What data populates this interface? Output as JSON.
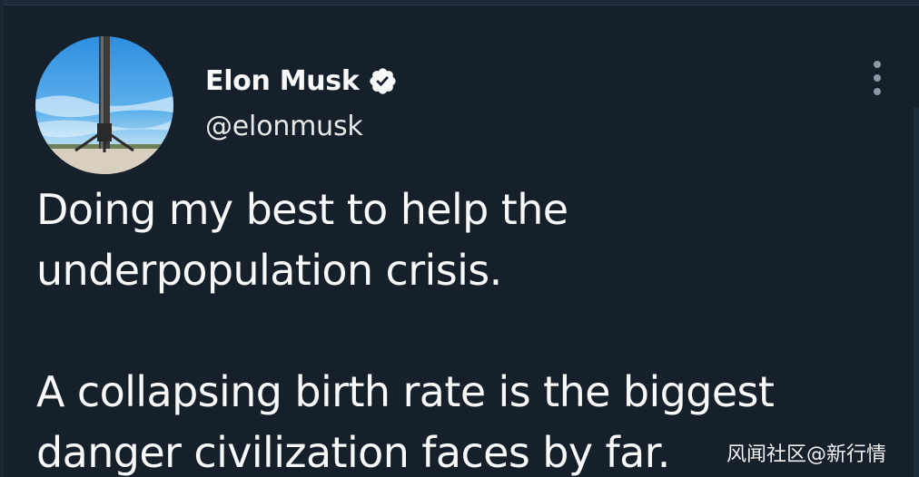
{
  "tweet": {
    "display_name": "Elon Musk",
    "handle": "@elonmusk",
    "verified": true,
    "text_lines": [
      "Doing my best to help the",
      "underpopulation crisis.",
      "A collapsing birth rate is the biggest",
      "danger civilization faces by far."
    ]
  },
  "icons": {
    "verified": "verified-badge-icon",
    "more": "more-vertical-icon",
    "avatar": "rocket-booster-avatar"
  },
  "colors": {
    "background": "#15202b",
    "text": "#f7f9f9",
    "muted": "#8b98a5"
  },
  "watermark": "风闻社区@新行情"
}
